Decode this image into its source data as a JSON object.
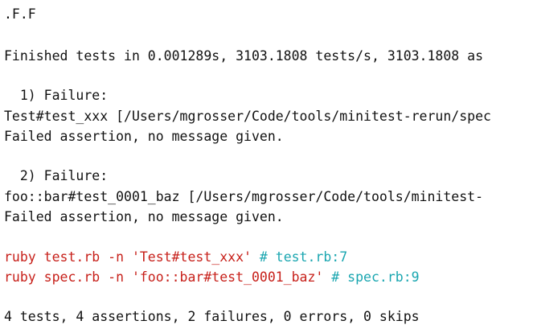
{
  "terminal": {
    "progress": ".F.F",
    "finished": "Finished tests in 0.001289s, 3103.1808 tests/s, 3103.1808 as",
    "failures": [
      {
        "header": "  1) Failure:",
        "location": "Test#test_xxx [/Users/mgrosser/Code/tools/minitest-rerun/spec",
        "message": "Failed assertion, no message given."
      },
      {
        "header": "  2) Failure:",
        "location": "foo::bar#test_0001_baz [/Users/mgrosser/Code/tools/minitest-",
        "message": "Failed assertion, no message given."
      }
    ],
    "rerun": [
      {
        "command": "ruby test.rb -n 'Test#test_xxx'",
        "comment": "# test.rb:7"
      },
      {
        "command": "ruby spec.rb -n 'foo::bar#test_0001_baz'",
        "comment": "# spec.rb:9"
      }
    ],
    "summary": "4 tests, 4 assertions, 2 failures, 0 errors, 0 skips"
  },
  "colors": {
    "text": "#111111",
    "command": "#c7201a",
    "comment": "#1aa6b0",
    "background": "#ffffff"
  }
}
